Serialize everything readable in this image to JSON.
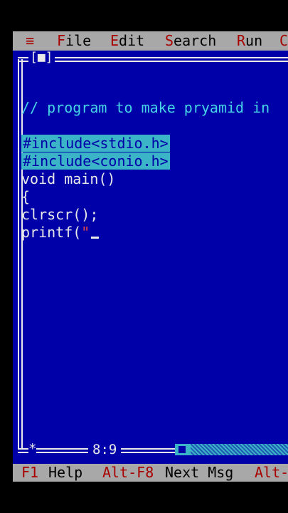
{
  "menu": {
    "system": "≡",
    "file": "File",
    "edit": "Edit",
    "search": "Search",
    "run": "Run",
    "next_partial": "C"
  },
  "window": {
    "close_box": "[■]"
  },
  "code_lines": [
    "// program to make pryamid in",
    "",
    "#include<stdio.h>",
    "#include<conio.h>",
    "void main()",
    "{",
    "clrscr();",
    "printf("
  ],
  "code_extra": {
    "open_quote": "\""
  },
  "editor_status": {
    "position": "8:9",
    "marker": "*"
  },
  "statusbar": {
    "f1_key": "F1",
    "f1_label": "Help",
    "altf8_key": "Alt-F8",
    "altf8_label": "Next Msg",
    "alt_partial": "Alt-"
  },
  "colors": {
    "editor_bg": "#0000a8",
    "menu_bg": "#a8a8a8",
    "hotkey": "#a80000",
    "comment": "#46d4e6",
    "selection": "#3cb4c8"
  }
}
